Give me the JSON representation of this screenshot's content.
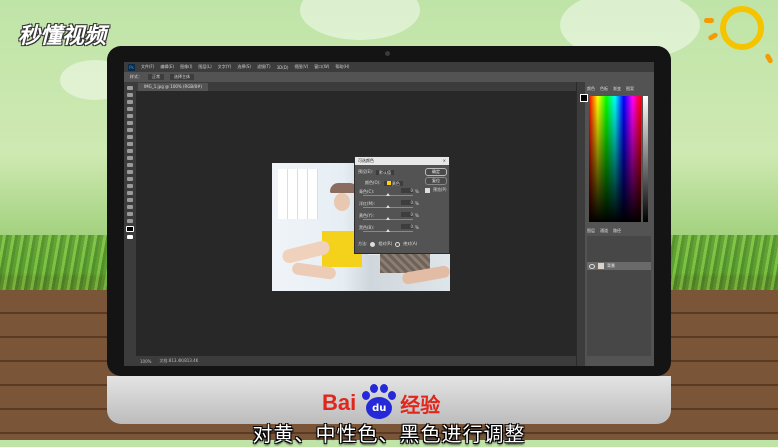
{
  "watermark": {
    "brand": "秒懂视频"
  },
  "photoshop": {
    "menu": [
      "文件(F)",
      "编辑(E)",
      "图像(I)",
      "图层(L)",
      "文字(Y)",
      "选择(S)",
      "滤镜(T)",
      "3D(D)",
      "视图(V)",
      "窗口(W)",
      "帮助(H)"
    ],
    "options": {
      "label": "样式：",
      "value": "正常",
      "extra": "选择主体"
    },
    "doc_tab": "IMG_1.jpg @ 100% (RGB/8#)",
    "status": {
      "zoom": "100%",
      "doc": "文档:813.4K/813.4K"
    }
  },
  "dialog": {
    "title": "可选颜色",
    "preset_label": "预设(E):",
    "preset_value": "默认值",
    "colors_label": "颜色(O):",
    "colors_value": "黄色",
    "ok": "确定",
    "reset": "复位",
    "preview": "预览(P)",
    "sliders": [
      {
        "label": "青色(C):",
        "value": "0",
        "unit": "%",
        "level": 0.5
      },
      {
        "label": "洋红(M):",
        "value": "0",
        "unit": "%",
        "level": 0.5
      },
      {
        "label": "黄色(Y):",
        "value": "0",
        "unit": "%",
        "level": 0.5
      },
      {
        "label": "黑色(B):",
        "value": "0",
        "unit": "%",
        "level": 0.5
      }
    ],
    "method_label": "方法:",
    "relative": "相对(R)",
    "absolute": "绝对(A)",
    "close_glyph": "×"
  },
  "panels": {
    "color_tabs": [
      "颜色",
      "色板",
      "渐变",
      "图案"
    ],
    "layers_tabs": [
      "图层",
      "通道",
      "路径"
    ],
    "layer_name": "背景"
  },
  "footer": {
    "bai": "Bai",
    "du": "du",
    "jingyan": "经验",
    "subtitle": "对黄、中性色、黑色进行调整"
  }
}
